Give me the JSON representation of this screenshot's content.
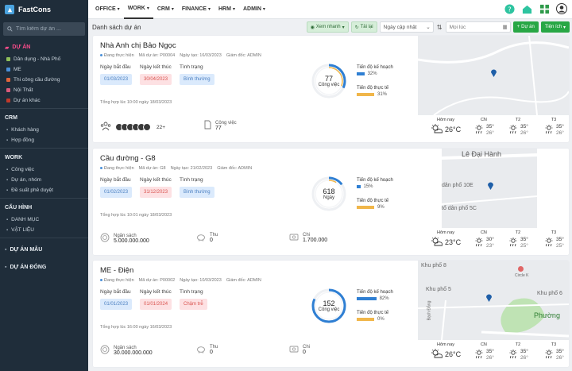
{
  "app": {
    "name": "FastCons"
  },
  "sidebar": {
    "search_placeholder": "Tìm kiếm dự án ...",
    "sections": [
      {
        "label": "DỰ ÁN",
        "items": [
          {
            "label": "Dân dụng - Nhà Phố",
            "color": "#8fbf5a"
          },
          {
            "label": "ME",
            "color": "#4a90d9"
          },
          {
            "label": "Thi công cầu đường",
            "color": "#e0643c"
          },
          {
            "label": "Nội Thất",
            "color": "#d95a7a"
          },
          {
            "label": "Dự án khác",
            "color": "#c0392b"
          }
        ]
      },
      {
        "label": "CRM",
        "items": [
          {
            "label": "Khách hàng"
          },
          {
            "label": "Hợp đồng"
          }
        ]
      },
      {
        "label": "WORK",
        "items": [
          {
            "label": "Công việc"
          },
          {
            "label": "Dự án, nhóm"
          },
          {
            "label": "Đề suất phê duyệt"
          }
        ]
      },
      {
        "label": "CẤU HÌNH",
        "items": [
          {
            "label": "DANH MỤC"
          },
          {
            "label": "VẬT LIỆU"
          }
        ]
      }
    ],
    "extra": [
      "DỰ ÁN MẪU",
      "DỰ ÁN ĐÓNG"
    ]
  },
  "topnav": [
    "OFFICE",
    "WORK",
    "CRM",
    "FINANCE",
    "HRM",
    "ADMIN"
  ],
  "toolbar": {
    "title": "Danh sách dự án",
    "quick_view": "Xem nhanh",
    "reload": "Tải lại",
    "sort_select": "Ngày cập nhật",
    "date_placeholder": "Mọi lúc",
    "add_project": "Dự án",
    "utility": "Tiện ích"
  },
  "labels": {
    "start": "Ngày bắt đầu",
    "end": "Ngày kết thúc",
    "status": "Tình trạng",
    "plan_progress": "Tiến độ kế hoạch",
    "actual_progress": "Tiến độ thực tế",
    "today": "Hôm nay",
    "budget": "Ngân sách",
    "income": "Thu",
    "expense": "Chi",
    "tasks": "Công việc"
  },
  "projects": [
    {
      "name": "Nhà Anh chị Bảo Ngọc",
      "status_text": "Đang thực hiện",
      "code": "Mã dự án: P00004",
      "created": "Ngày tạo: 16/03/2023",
      "manager": "Giám đốc: ADMIN",
      "start": "01/03/2023",
      "end": "30/04/2023",
      "condition": "Bình thường",
      "condition_style": "blue",
      "summary": "Tổng hợp lúc 10:00 ngày 18/03/2023",
      "center_value": "77",
      "center_label": "Công việc",
      "plan_pct": 32,
      "actual_pct": 31,
      "plan_text": "32%",
      "actual_text": "31%",
      "bottom_mode": "tasks",
      "members_more": "22+",
      "tasks_label": "Công việc",
      "tasks_count": "77",
      "map_labels": [],
      "weather": {
        "today": "26°C",
        "days": [
          {
            "day": "CN",
            "hi": "35°",
            "lo": "26°"
          },
          {
            "day": "T2",
            "hi": "35°",
            "lo": "26°"
          },
          {
            "day": "T3",
            "hi": "35°",
            "lo": "26°"
          }
        ]
      }
    },
    {
      "name": "Cầu đường - G8",
      "status_text": "Đang thực hiện",
      "code": "Mã dự án: G8",
      "created": "Ngày tạo: 21/02/2023",
      "manager": "Giám đốc: ADMIN",
      "start": "01/02/2023",
      "end": "31/12/2023",
      "condition": "Bình thường",
      "condition_style": "blue",
      "summary": "Tổng hợp lúc 10:01 ngày 18/03/2023",
      "center_value": "618",
      "center_label": "Ngày",
      "plan_pct": 15,
      "actual_pct": 9,
      "plan_text": "15%",
      "actual_text": "9%",
      "bottom_mode": "finance",
      "budget": "5.000.000.000",
      "income": "0",
      "expense": "1.700.000",
      "map_labels": [
        "Lê Đại Hành",
        "dân phố 10E",
        "tổ dân phố 5C"
      ],
      "weather": {
        "today": "23°C",
        "days": [
          {
            "day": "CN",
            "hi": "30°",
            "lo": "23°"
          },
          {
            "day": "T2",
            "hi": "35°",
            "lo": "25°"
          },
          {
            "day": "T3",
            "hi": "35°",
            "lo": "25°"
          }
        ]
      }
    },
    {
      "name": "ME - Điện",
      "status_text": "Đang thực hiện",
      "code": "Mã dự án: P00002",
      "created": "Ngày tạo: 10/03/2023",
      "manager": "Giám đốc: ADMIN",
      "start": "01/01/2023",
      "end": "01/01/2024",
      "condition": "Chậm trễ",
      "condition_style": "red",
      "summary": "Tổng hợp lúc 16:00 ngày 16/03/2023",
      "center_value": "152",
      "center_label": "Công việc",
      "plan_pct": 82,
      "actual_pct": 0,
      "plan_text": "82%",
      "actual_text": "0%",
      "bottom_mode": "finance",
      "budget": "30.000.000.000",
      "income": "0",
      "expense": "0",
      "map_labels": [
        "Circle K",
        "Khu phố 8",
        "Khu phố 5",
        "Khu phố 6",
        "Phường",
        "Bạch Đằng"
      ],
      "weather": {
        "today": "26°C",
        "days": [
          {
            "day": "CN",
            "hi": "35°",
            "lo": "26°"
          },
          {
            "day": "T2",
            "hi": "35°",
            "lo": "26°"
          },
          {
            "day": "T3",
            "hi": "35°",
            "lo": "26°"
          }
        ]
      }
    }
  ],
  "colors": {
    "accent_blue": "#2f7fd3",
    "plan_bar": "#2f7fd3",
    "actual_bar": "#f0b64a",
    "green": "#28a745",
    "pin": "#1f5fa8"
  }
}
